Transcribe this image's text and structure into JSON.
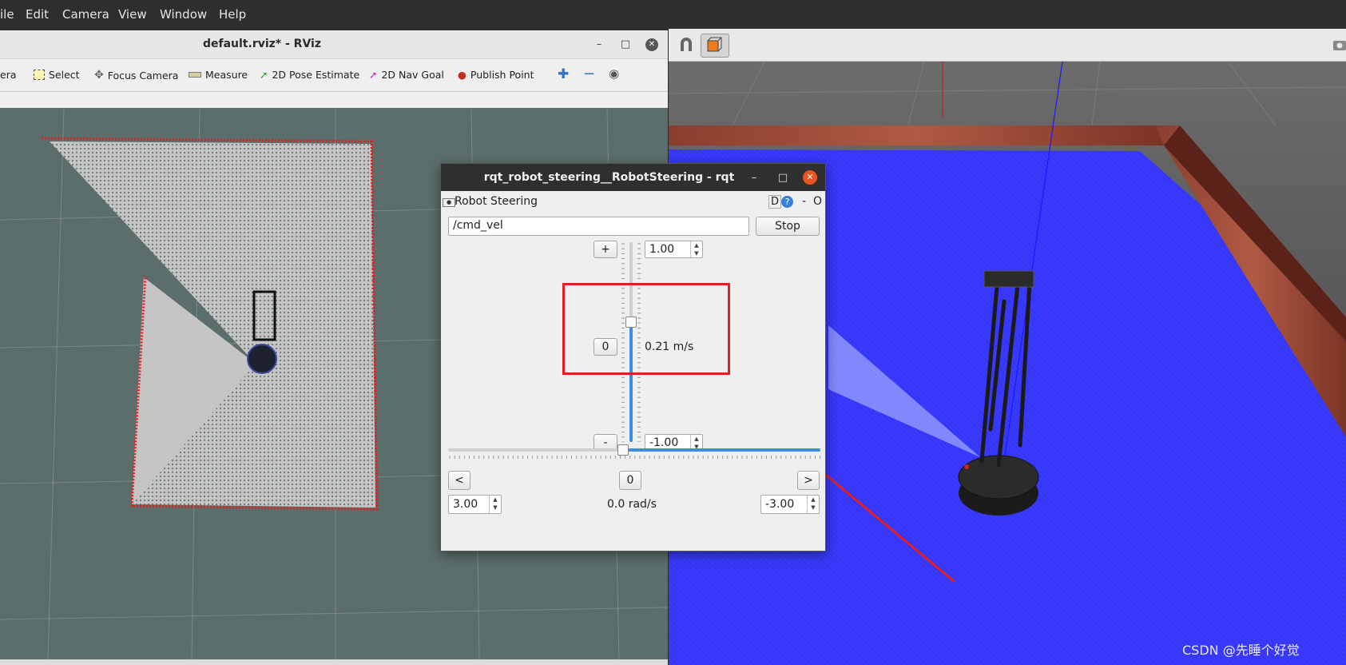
{
  "menubar": {
    "items": [
      "ile",
      "Edit",
      "Camera",
      "View",
      "Window",
      "Help"
    ]
  },
  "rviz": {
    "title": "default.rviz* - RViz",
    "window_buttons": {
      "minimize": "–",
      "maximize": "□",
      "close": "✕"
    },
    "toolbar": {
      "camera_partial": "era",
      "select": "Select",
      "focus_camera": "Focus Camera",
      "measure": "Measure",
      "pose_estimate": "2D Pose Estimate",
      "nav_goal": "2D Nav Goal",
      "publish_point": "Publish Point"
    }
  },
  "rqt": {
    "title": "rqt_robot_steering__RobotSteering - rqt",
    "window_buttons": {
      "minimize": "–",
      "maximize": "□",
      "close": "✕"
    },
    "plugin_name": "Robot Steering",
    "plugin_controls": {
      "d": "D",
      "help": "?",
      "dash": "-",
      "o": "O"
    },
    "topic_value": "/cmd_vel",
    "stop_label": "Stop",
    "linear": {
      "max_value": "1.00",
      "min_value": "-1.00",
      "plus_label": "+",
      "minus_label": "-",
      "zero_label": "0",
      "current": "0.21 m/s",
      "slider_level": 0.21
    },
    "angular": {
      "left_value": "3.00",
      "right_value": "-3.00",
      "left_label": "<",
      "right_label": ">",
      "zero_label": "0",
      "current": "0.0 rad/s",
      "slider_level": 0.0
    }
  },
  "watermark": "CSDN @先睡个好觉",
  "colors": {
    "highlight_box": "#e02020",
    "arrow": "#e02020",
    "gazebo_floor": "#3a3aff",
    "rviz_grid_bg": "#5c6e6c",
    "slider_blue": "#3d8ee0"
  }
}
